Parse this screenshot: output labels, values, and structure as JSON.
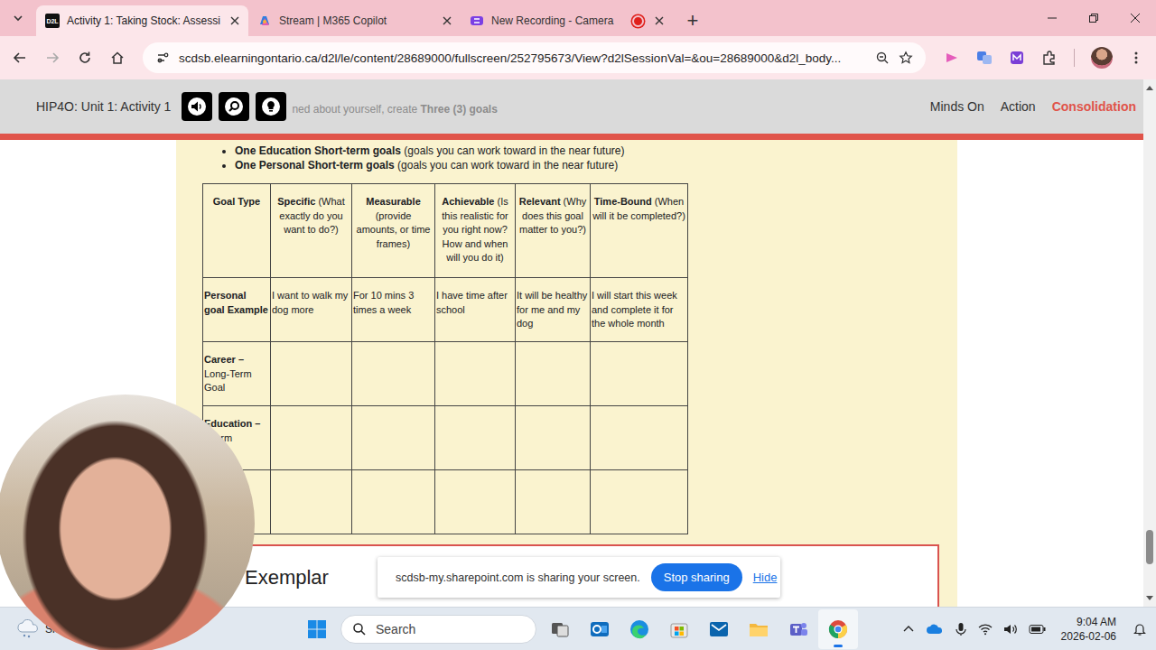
{
  "browser": {
    "tabs": [
      {
        "title": "Activity 1: Taking Stock: Assessi",
        "icon_text": "D2L",
        "kind": "d2l",
        "selected": true,
        "recording": false
      },
      {
        "title": "Stream | M365 Copilot",
        "kind": "copilot",
        "selected": false,
        "recording": false
      },
      {
        "title": "New Recording - Camera",
        "kind": "clipchamp",
        "selected": false,
        "recording": true
      }
    ],
    "new_tab": "+",
    "url": "scdsb.elearningontario.ca/d2l/le/content/28689000/fullscreen/252795673/View?d2lSessionVal=&ou=28689000&d2l_body..."
  },
  "header": {
    "title": "HIP4O: Unit 1: Activity 1",
    "faded_text": "ned about yourself, create ",
    "faded_bold": "Three (3) goals",
    "nav": [
      {
        "label": "Minds On",
        "selected": false
      },
      {
        "label": "Action",
        "selected": false
      },
      {
        "label": "Consolidation",
        "selected": true
      }
    ]
  },
  "scroll": {
    "level": 0.94,
    "thumb": 0.07
  },
  "bullets": [
    {
      "bold": "One Education Short-term goals",
      "rest": " (goals you can work toward in the near future)"
    },
    {
      "bold": "One Personal Short-term goals",
      "rest": " (goals you can work toward in the near future)"
    }
  ],
  "table": {
    "columns": [
      {
        "bold": "Goal Type"
      },
      {
        "bold": "Specific",
        "rest": " (What exactly do you want to do?)"
      },
      {
        "bold": "Measurable",
        "rest": " (provide amounts, or time frames)"
      },
      {
        "bold": "Achievable",
        "rest": " (Is this realistic for you right now? How and when will you do it)"
      },
      {
        "bold": "Relevant",
        "rest": " (Why does this goal matter to you?)"
      },
      {
        "bold": "Time-Bound",
        "rest": " (When will it be completed?)"
      }
    ],
    "rows": [
      {
        "label_bold": "Personal goal Example",
        "cells": [
          "I want to walk my dog more",
          "For 10 mins 3 times a week",
          "I have time after school",
          "It will be healthy for me and my dog",
          "I will start this week and complete it for the whole month"
        ]
      },
      {
        "label_bold": "Career –",
        "label_rest": "Long-Term Goal",
        "cells": []
      },
      {
        "label_bold": "Education –",
        "label_rest": "t-Term",
        "cells": []
      },
      {
        "cells": []
      }
    ]
  },
  "exemplar": "Exemplar",
  "share_bar": {
    "message": "scdsb-my.sharepoint.com is sharing your screen.",
    "stop": "Stop sharing",
    "hide": "Hide"
  },
  "taskbar": {
    "weather": "Snow",
    "search": "Search",
    "apps": [
      {
        "kind": "taskview",
        "running": false
      },
      {
        "kind": "outlook-new",
        "running": false
      },
      {
        "kind": "edge",
        "running": false
      },
      {
        "kind": "store",
        "running": false
      },
      {
        "kind": "outlook",
        "running": false
      },
      {
        "kind": "explorer",
        "running": false
      },
      {
        "kind": "teams",
        "running": false
      },
      {
        "kind": "chrome",
        "running": true
      }
    ],
    "time": "9:04 AM",
    "date": "2026-02-06"
  }
}
